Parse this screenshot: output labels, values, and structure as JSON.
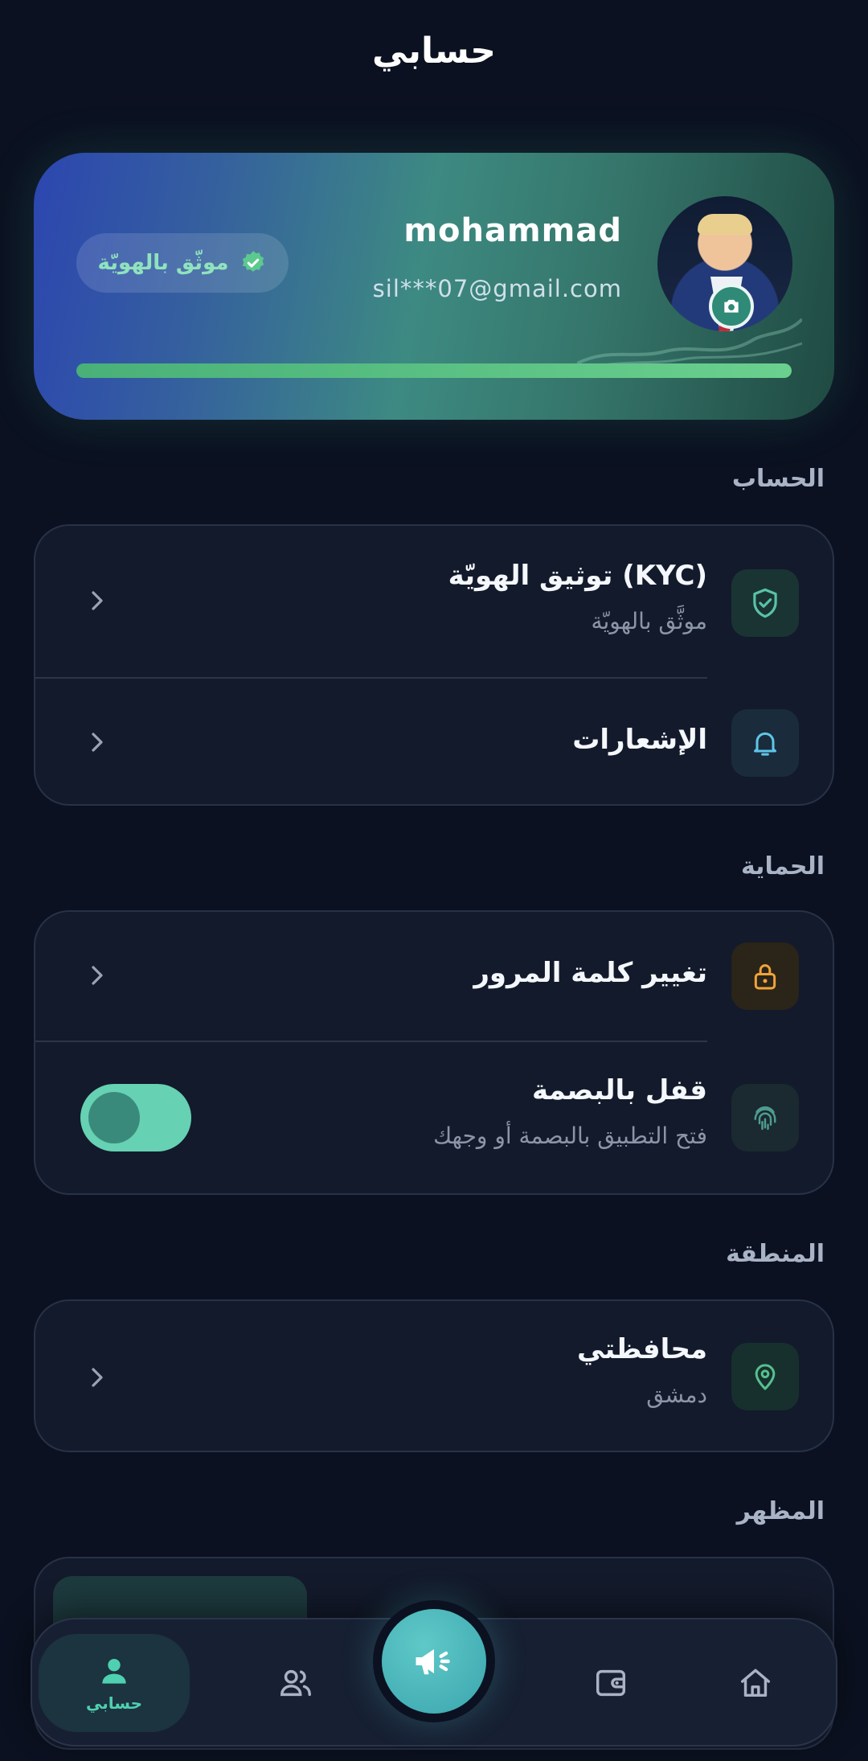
{
  "header": {
    "title": "حسابي"
  },
  "profile": {
    "name": "mohammad",
    "email": "sil***07@gmail.com",
    "verified_label": "موثّق بالهويّة",
    "progress": 1.0
  },
  "sections": {
    "account": {
      "label": "الحساب",
      "kyc": {
        "title": "توثيق الهويّة (KYC)",
        "subtitle": "موثَّق بالهويّة"
      },
      "notifications": {
        "title": "الإشعارات"
      }
    },
    "security": {
      "label": "الحماية",
      "change_password": {
        "title": "تغيير كلمة المرور"
      },
      "biometric_lock": {
        "title": "قفل بالبصمة",
        "subtitle": "فتح التطبيق بالبصمة أو وجهك",
        "enabled": true
      }
    },
    "region": {
      "label": "المنطقة",
      "governorate": {
        "title": "محافظتي",
        "value": "دمشق"
      }
    },
    "appearance": {
      "label": "المظهر"
    }
  },
  "nav": {
    "items": [
      {
        "name": "profile",
        "label": "حسابي",
        "active": true
      },
      {
        "name": "contacts",
        "label": ""
      },
      {
        "name": "announcements",
        "label": ""
      },
      {
        "name": "wallet",
        "label": ""
      },
      {
        "name": "home",
        "label": ""
      }
    ]
  },
  "colors": {
    "background": "#0b1120",
    "card": "#131a2b",
    "accent_teal": "#66d1b3",
    "accent_green": "#6ad08e",
    "lock_orange": "#f0a33a",
    "bell_blue": "#5ec6e8"
  }
}
